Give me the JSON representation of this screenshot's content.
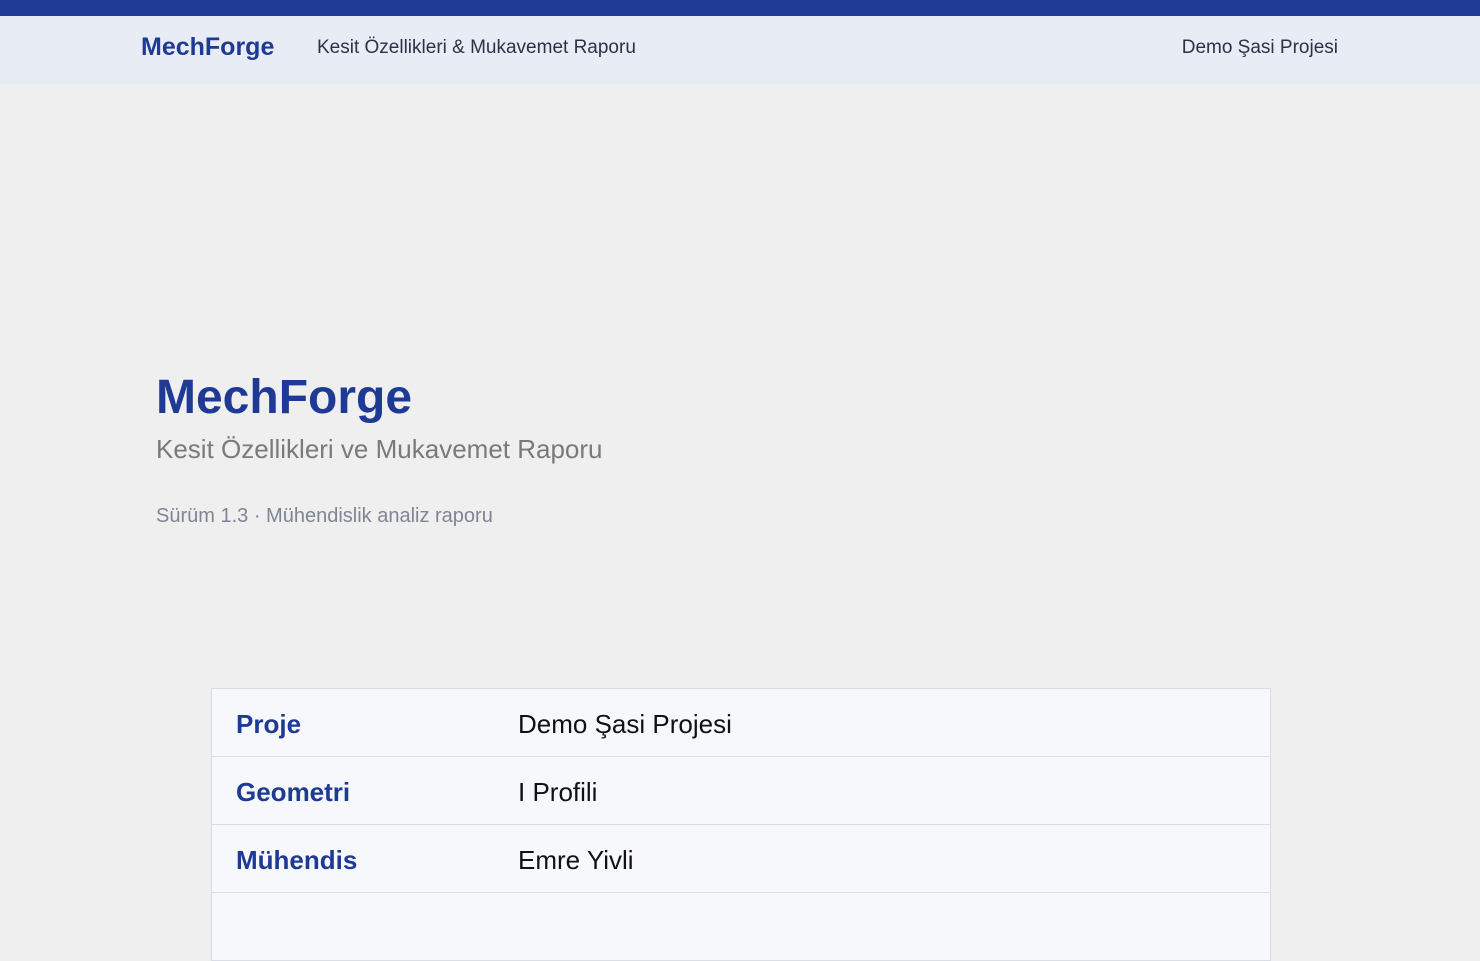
{
  "header": {
    "brand": "MechForge",
    "subtitle": "Kesit Özellikleri & Mukavemet Raporu",
    "project": "Demo Şasi Projesi"
  },
  "cover": {
    "title": "MechForge",
    "report_name": "Kesit Özellikleri ve Mukavemet Raporu",
    "version": "Sürüm 1.3 · Mühendislik analiz raporu"
  },
  "info": [
    {
      "key": "Proje",
      "value": "Demo Şasi Projesi"
    },
    {
      "key": "Geometri",
      "value": "I Profili"
    },
    {
      "key": "Mühendis",
      "value": "Emre Yivli"
    },
    {
      "key": "",
      "value": ""
    }
  ],
  "colors": {
    "accent": "#1e3a94",
    "header_bg": "#e8edf5",
    "page_bg": "#efefef"
  }
}
